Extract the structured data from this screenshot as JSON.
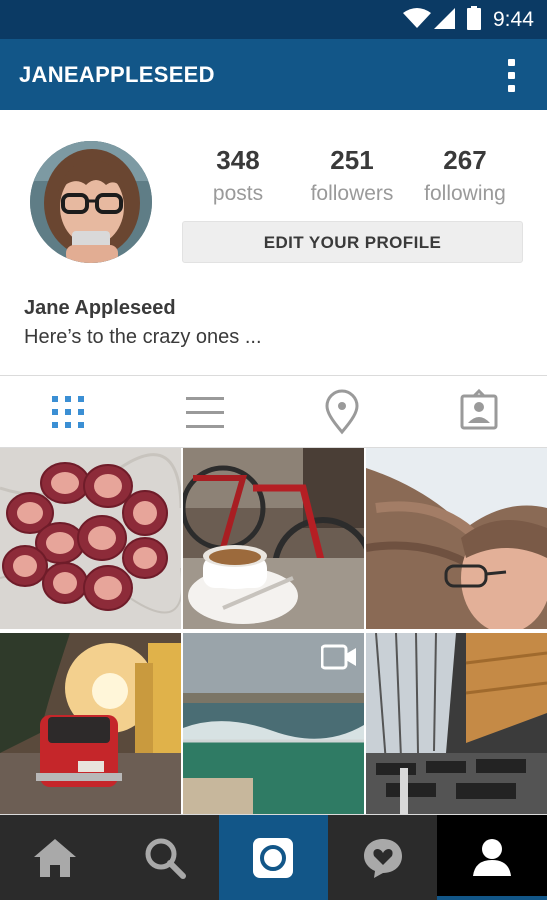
{
  "status_bar": {
    "time": "9:44",
    "icons": [
      "wifi-icon",
      "signal-icon",
      "battery-icon"
    ]
  },
  "app_bar": {
    "username": "JANEAPPLESEED",
    "overflow_icon": "more-vert-icon"
  },
  "profile": {
    "stats": [
      {
        "value": "348",
        "label": "posts"
      },
      {
        "value": "251",
        "label": "followers"
      },
      {
        "value": "267",
        "label": "following"
      }
    ],
    "edit_button_label": "EDIT YOUR PROFILE",
    "full_name": "Jane Appleseed",
    "bio": "Here’s to the crazy ones ..."
  },
  "view_tabs": [
    {
      "icon": "grid-icon",
      "active": true
    },
    {
      "icon": "list-icon",
      "active": false
    },
    {
      "icon": "location-pin-icon",
      "active": false
    },
    {
      "icon": "tagged-photos-icon",
      "active": false
    }
  ],
  "posts": [
    {
      "subject": "figs-on-marble"
    },
    {
      "subject": "coffee-and-bicycles"
    },
    {
      "subject": "windswept-portrait"
    },
    {
      "subject": "red-car-sunset"
    },
    {
      "subject": "ocean-pool",
      "is_video": true
    },
    {
      "subject": "airport-terminal"
    }
  ],
  "bottom_nav": [
    {
      "icon": "home-icon",
      "active": false
    },
    {
      "icon": "search-icon",
      "active": false
    },
    {
      "icon": "camera-icon",
      "active": false
    },
    {
      "icon": "activity-heart-icon",
      "active": false
    },
    {
      "icon": "profile-icon",
      "active": true
    }
  ],
  "colors": {
    "status_bar": "#0b3a64",
    "app_bar": "#125688",
    "active_tab": "#3b8fd4",
    "nav_background": "#2b2b2b",
    "nav_camera": "#125688",
    "nav_active": "#000000"
  }
}
